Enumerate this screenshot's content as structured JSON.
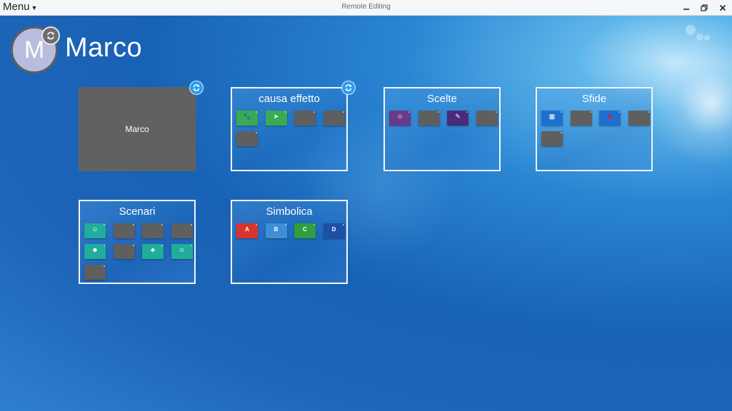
{
  "titlebar": {
    "menu_label": "Menu",
    "window_title": "Remote Editing"
  },
  "profile": {
    "avatar_letter": "M",
    "user_name": "Marco"
  },
  "tiles": {
    "marco": {
      "label": "Marco"
    },
    "causa_effetto": {
      "title": "causa effetto",
      "thumbs": [
        {
          "color": "#3aaa55",
          "icon": "animal-picture-icon"
        },
        {
          "color": "#3aaa55",
          "icon": "pointer-picture-icon"
        },
        {
          "color": "#5f5f5f",
          "caption": ""
        },
        {
          "color": "#5f5f5f",
          "caption": ""
        },
        {
          "color": "#5f5f5f",
          "caption": ""
        }
      ]
    },
    "scelte": {
      "title": "Scelte",
      "thumbs": [
        {
          "color": "#6a3a8a",
          "icon": "person-icon"
        },
        {
          "color": "#5f5f5f",
          "caption": ""
        },
        {
          "color": "#4a2a7a",
          "icon": "pencil-icon"
        },
        {
          "color": "#5f5f5f",
          "caption": ""
        }
      ]
    },
    "sfide": {
      "title": "Sfide",
      "thumbs": [
        {
          "color": "#1f6fd0",
          "icon": "qr-code-icon"
        },
        {
          "color": "#5f5f5f",
          "caption": ""
        },
        {
          "color": "#1f6fd0",
          "icon": "red-shape-icon"
        },
        {
          "color": "#5f5f5f",
          "caption": ""
        },
        {
          "color": "#5f5f5f",
          "caption": ""
        }
      ]
    },
    "scenari": {
      "title": "Scenari",
      "thumbs": [
        {
          "color": "#1fae9a",
          "icon": "person-icon"
        },
        {
          "color": "#5f5f5f",
          "caption": ""
        },
        {
          "color": "#5f5f5f",
          "caption": ""
        },
        {
          "color": "#5f5f5f",
          "caption": ""
        },
        {
          "color": "#1fae9a",
          "icon": "face-icon"
        },
        {
          "color": "#5f5f5f",
          "caption": ""
        },
        {
          "color": "#1fae9a",
          "icon": "scene-icon"
        },
        {
          "color": "#1fae9a",
          "icon": "person-icon"
        },
        {
          "color": "#5f5f5f",
          "caption": ""
        }
      ]
    },
    "simbolica": {
      "title": "Simbolica",
      "thumbs": [
        {
          "color": "#d9342b",
          "letter": "A"
        },
        {
          "color": "#3d8fd6",
          "letter": "B"
        },
        {
          "color": "#2f9e3e",
          "letter": "C"
        },
        {
          "color": "#1e4fa8",
          "letter": "D"
        }
      ]
    }
  },
  "colors": {
    "accent": "#2f9cf0",
    "tile_grey": "#616161",
    "tile_border": "#f2f6fa"
  }
}
